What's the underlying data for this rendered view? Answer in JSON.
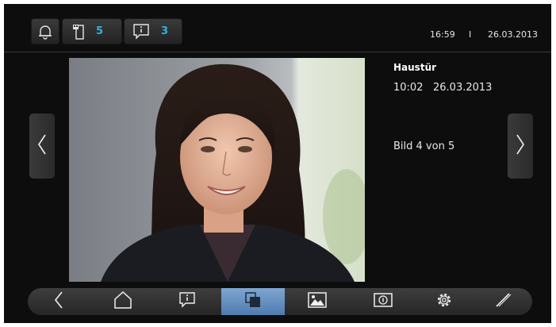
{
  "status": {
    "notification_count": "5",
    "message_count": "3",
    "time": "16:59",
    "separator": "I",
    "date": "26.03.2013"
  },
  "image_info": {
    "location": "Haustür",
    "time": "10:02",
    "date": "26.03.2013",
    "counter": "Bild 4 von 5"
  },
  "icons": {
    "bell": "bell-icon",
    "door_intercom": "door-intercom-icon",
    "message": "message-icon",
    "prev": "chevron-left-icon",
    "next": "chevron-right-icon"
  },
  "toolbar": {
    "items": [
      "back-icon",
      "home-icon",
      "message-icon",
      "gallery-icon",
      "image-icon",
      "info-icon",
      "settings-icon",
      "edit-icon"
    ],
    "active": "gallery-icon"
  },
  "colors": {
    "accent": "#2fb3e6",
    "active_toolbar": "#6a93c4",
    "background": "#0d0d0d"
  }
}
